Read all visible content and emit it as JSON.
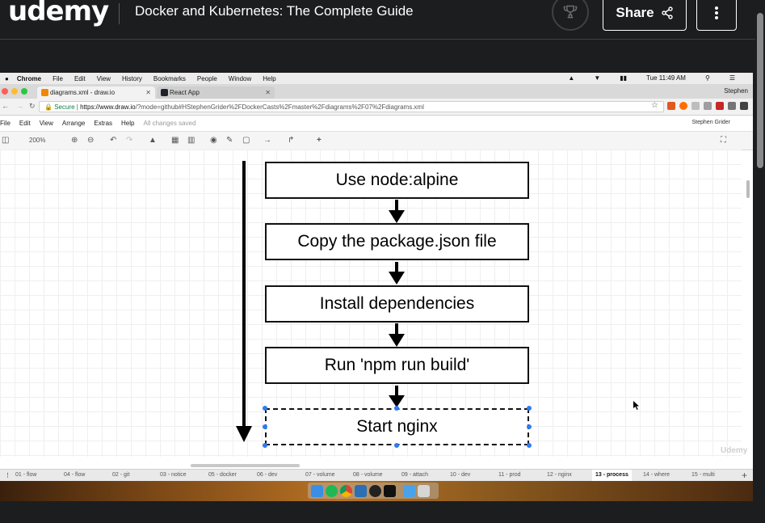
{
  "header": {
    "logo": "udemy",
    "course_title": "Docker and Kubernetes: The Complete Guide",
    "share_label": "Share",
    "trophy_icon": "trophy-icon",
    "share_icon": "share-icon",
    "more_icon": "more-vertical-icon"
  },
  "mac_menubar": {
    "items": [
      "Chrome",
      "File",
      "Edit",
      "View",
      "History",
      "Bookmarks",
      "People",
      "Window",
      "Help"
    ],
    "clock": "Tue 11:49 AM"
  },
  "chrome": {
    "tabs": [
      {
        "label": "diagrams.xml - draw.io",
        "active": true
      },
      {
        "label": "React App",
        "active": false
      }
    ],
    "user": "Stephen",
    "secure_label": "Secure",
    "url_host": "https://www.draw.io",
    "url_path": "/?mode=github#HStephenGrider%2FDockerCasts%2Fmaster%2Fdiagrams%2F07%2Fdiagrams.xml"
  },
  "drawio": {
    "menu": [
      "File",
      "Edit",
      "View",
      "Arrange",
      "Extras",
      "Help"
    ],
    "saved_status": "All changes saved",
    "user": "Stephen Grider",
    "zoom": "200%"
  },
  "diagram": {
    "steps": [
      "Use node:alpine",
      "Copy the package.json file",
      "Install dependencies",
      "Run 'npm run build'",
      "Start nginx"
    ],
    "watermark": "Udemy"
  },
  "page_tabs": [
    "01 - flow",
    "04 - flow",
    "02 - git",
    "03 - notice",
    "05 - docker",
    "06 - dev",
    "07 - volume",
    "08 - volume",
    "09 - attach",
    "10 - dev",
    "11 - prod",
    "12 - nginx",
    "13 - process",
    "14 - where",
    "15 - multi"
  ],
  "active_page_tab": "13 - process",
  "colors": {
    "udemy_bg": "#1c1d1f",
    "selection_handle": "#2d7bf4",
    "secure_green": "#0b8043"
  }
}
